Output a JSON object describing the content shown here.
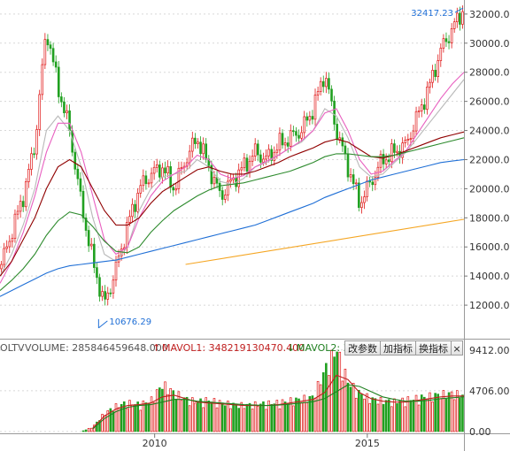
{
  "chart_data": {
    "type": "candlestick",
    "price_axis": {
      "ticks": [
        "32000.0",
        "30000.0",
        "28000.0",
        "26000.0",
        "24000.0",
        "22000.0",
        "20000.0",
        "18000.0",
        "16000.0",
        "14000.0",
        "12000.0"
      ],
      "range": [
        10000,
        32600
      ]
    },
    "annotations": {
      "high": "32417.23",
      "low": "10676.29"
    },
    "x_ticks": [
      "2010",
      "2015"
    ],
    "price_series": {
      "x": [
        0,
        3,
        6,
        9,
        12,
        15,
        18,
        21,
        24,
        27,
        30,
        33,
        36,
        39,
        42,
        45,
        48,
        51,
        54,
        57,
        60,
        63,
        66,
        69,
        72,
        75,
        78,
        81,
        84,
        87,
        90,
        93,
        96,
        99,
        102,
        105,
        108,
        111,
        114,
        117,
        120
      ],
      "close": [
        14500,
        17000,
        19500,
        23000,
        31000,
        27000,
        24000,
        19000,
        15000,
        12000,
        14500,
        17500,
        20000,
        21000,
        21500,
        20000,
        22000,
        23500,
        21500,
        19500,
        20500,
        21500,
        22500,
        22000,
        23000,
        23500,
        24000,
        25500,
        28000,
        24000,
        21500,
        19000,
        20500,
        22000,
        22500,
        23000,
        25000,
        27000,
        29500,
        31000,
        32400
      ]
    },
    "ma_series": [
      {
        "color": "#b8b8b8",
        "values": [
          14000,
          15500,
          17500,
          20000,
          24000,
          25000,
          24000,
          21500,
          18000,
          15500,
          15000,
          16000,
          18500,
          20000,
          20800,
          21000,
          21200,
          22000,
          21500,
          20500,
          20300,
          20700,
          21500,
          21800,
          22300,
          22800,
          23200,
          24000,
          25500,
          25000,
          23500,
          21500,
          20800,
          21000,
          21800,
          22500,
          23500,
          24500,
          25500,
          26500,
          27500
        ]
      },
      {
        "color": "#e860c0",
        "values": [
          13500,
          15000,
          17000,
          19500,
          22500,
          24500,
          24500,
          22500,
          19500,
          16500,
          15500,
          16000,
          18000,
          19500,
          20500,
          21000,
          21500,
          22300,
          22000,
          21000,
          20700,
          20900,
          21500,
          21900,
          22300,
          22800,
          23300,
          24000,
          25200,
          25500,
          24000,
          22000,
          21000,
          21200,
          21900,
          22600,
          23800,
          25000,
          26200,
          27200,
          28000
        ]
      },
      {
        "color": "#900000",
        "values": [
          14000,
          15000,
          16500,
          18000,
          20000,
          21500,
          22000,
          21500,
          20000,
          18500,
          17500,
          17500,
          18000,
          19000,
          19800,
          20300,
          20800,
          21300,
          21500,
          21200,
          21000,
          21000,
          21200,
          21500,
          21800,
          22200,
          22500,
          22800,
          23200,
          23400,
          23200,
          22700,
          22200,
          22100,
          22300,
          22600,
          22900,
          23200,
          23500,
          23700,
          23900
        ]
      },
      {
        "color": "#2e8b2e",
        "values": [
          13000,
          13700,
          14500,
          15500,
          16800,
          17800,
          18400,
          18200,
          17400,
          16400,
          15700,
          15600,
          16000,
          17000,
          17800,
          18500,
          19000,
          19500,
          19900,
          20200,
          20300,
          20400,
          20600,
          20800,
          21000,
          21200,
          21500,
          21800,
          22200,
          22400,
          22400,
          22300,
          22200,
          22200,
          22300,
          22500,
          22700,
          22900,
          23100,
          23300,
          23500
        ]
      },
      {
        "color": "#1f6fd6",
        "values": [
          12600,
          13000,
          13400,
          13800,
          14200,
          14500,
          14700,
          14800,
          14900,
          15000,
          15100,
          15300,
          15500,
          15700,
          15900,
          16100,
          16300,
          16500,
          16700,
          16900,
          17100,
          17300,
          17500,
          17800,
          18100,
          18400,
          18700,
          19000,
          19400,
          19700,
          20000,
          20300,
          20600,
          20800,
          21000,
          21200,
          21400,
          21600,
          21800,
          21900,
          22000
        ]
      },
      {
        "color": "#f5a623",
        "x": [
          48,
          120
        ],
        "values": [
          14800,
          17900
        ]
      }
    ],
    "volume_panel": {
      "header": {
        "title": "OLTV",
        "volume": "VOLUME: 285846459648.000",
        "mavol1": "MAVOL1: 348219130470.400",
        "mavol2": "MAVOL2: 35"
      },
      "ticks": [
        "9412.00",
        "4706.00",
        "0.00"
      ],
      "range": [
        0,
        10000
      ],
      "x": [
        0,
        3,
        6,
        9,
        12,
        15,
        18,
        21,
        24,
        27,
        30,
        33,
        36,
        39,
        42,
        45,
        48,
        51,
        54,
        57,
        60,
        63,
        66,
        69,
        72,
        75,
        78,
        81,
        84,
        87,
        90,
        93,
        96,
        99,
        102,
        105,
        108,
        111,
        114,
        117,
        120
      ],
      "volume": [
        0,
        0,
        0,
        0,
        0,
        0,
        0,
        0,
        500,
        2000,
        2800,
        3200,
        3000,
        3400,
        5200,
        4300,
        3600,
        3300,
        3500,
        3200,
        3000,
        2900,
        3000,
        3100,
        3200,
        3400,
        3600,
        3800,
        6800,
        9200,
        5500,
        4200,
        3600,
        3400,
        3300,
        3500,
        3700,
        3900,
        4100,
        4200,
        4000
      ],
      "mavol1": [
        0,
        0,
        0,
        0,
        0,
        0,
        0,
        0,
        400,
        1800,
        2600,
        3000,
        3100,
        3300,
        4000,
        4200,
        3800,
        3400,
        3300,
        3200,
        3100,
        3000,
        3000,
        3000,
        3100,
        3300,
        3500,
        3700,
        4500,
        6500,
        6000,
        4500,
        3800,
        3500,
        3400,
        3400,
        3600,
        3800,
        4000,
        4100,
        4100
      ],
      "mavol2": [
        0,
        0,
        0,
        0,
        0,
        0,
        0,
        0,
        300,
        1500,
        2300,
        2800,
        3000,
        3100,
        3400,
        3700,
        3700,
        3500,
        3400,
        3300,
        3200,
        3100,
        3050,
        3000,
        3050,
        3150,
        3300,
        3450,
        3800,
        4600,
        5400,
        5200,
        4600,
        4000,
        3700,
        3500,
        3500,
        3600,
        3800,
        3900,
        4000
      ]
    },
    "buttons": [
      "改参数",
      "加指标",
      "换指标"
    ],
    "close_glyph": "×",
    "colors": {
      "up": "#e01818",
      "down": "#20a020",
      "ma1": "#b8b8b8",
      "ma2": "#e860c0",
      "ma3": "#900000",
      "ma4": "#2e8b2e",
      "ma5": "#1f6fd6",
      "ma6": "#f5a623",
      "vol_label": "#555555",
      "mavol1": "#c02020",
      "mavol2": "#208020",
      "annotation": "#1f6fd6"
    }
  }
}
